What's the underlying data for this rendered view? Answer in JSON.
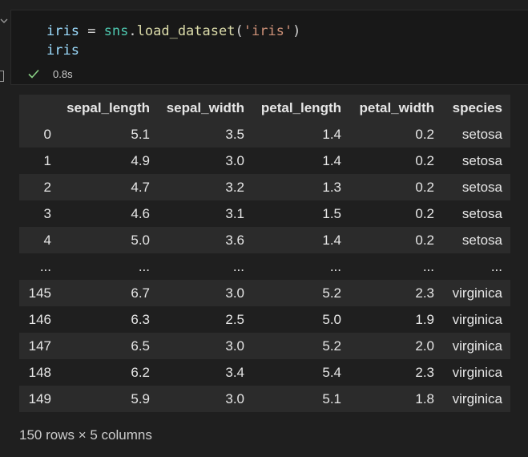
{
  "cell": {
    "code_line1": {
      "var": "iris",
      "op": " = ",
      "mod": "sns",
      "dot": ".",
      "fn": "load_dataset",
      "open": "(",
      "str": "'iris'",
      "close": ")"
    },
    "code_line2": "iris",
    "exec_time": "0.8s"
  },
  "table": {
    "columns": [
      "sepal_length",
      "sepal_width",
      "petal_length",
      "petal_width",
      "species"
    ],
    "rows": [
      [
        "0",
        "5.1",
        "3.5",
        "1.4",
        "0.2",
        "setosa"
      ],
      [
        "1",
        "4.9",
        "3.0",
        "1.4",
        "0.2",
        "setosa"
      ],
      [
        "2",
        "4.7",
        "3.2",
        "1.3",
        "0.2",
        "setosa"
      ],
      [
        "3",
        "4.6",
        "3.1",
        "1.5",
        "0.2",
        "setosa"
      ],
      [
        "4",
        "5.0",
        "3.6",
        "1.4",
        "0.2",
        "setosa"
      ],
      [
        "...",
        "...",
        "...",
        "...",
        "...",
        "..."
      ],
      [
        "145",
        "6.7",
        "3.0",
        "5.2",
        "2.3",
        "virginica"
      ],
      [
        "146",
        "6.3",
        "2.5",
        "5.0",
        "1.9",
        "virginica"
      ],
      [
        "147",
        "6.5",
        "3.0",
        "5.2",
        "2.0",
        "virginica"
      ],
      [
        "148",
        "6.2",
        "3.4",
        "5.4",
        "2.3",
        "virginica"
      ],
      [
        "149",
        "5.9",
        "3.0",
        "5.1",
        "1.8",
        "virginica"
      ]
    ]
  },
  "summary": "150 rows × 5 columns",
  "colors": {
    "check": "#89d185",
    "background": "#1f1f1f",
    "stripe": "#2b2b2b"
  }
}
